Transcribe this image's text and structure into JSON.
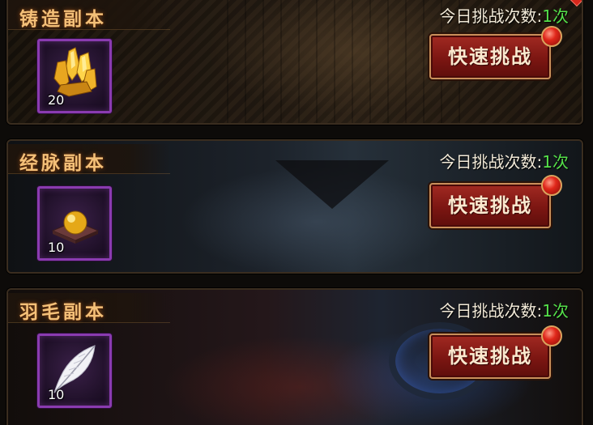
{
  "colors": {
    "title_text": "#f4c078",
    "attempts_text": "#f2ead8",
    "attempts_count": "#55e04a",
    "button_red": "#a22a22",
    "button_border": "#c98f5a",
    "slot_border_purple": "#8a3bb0",
    "notify_red": "#e0271a"
  },
  "dungeons": [
    {
      "title": "铸造副本",
      "attempts_label": "今日挑战次数:",
      "attempts_count": "1次",
      "button_label": "快速挑战",
      "reward": {
        "icon": "gold-crystal-icon",
        "quantity": "20"
      }
    },
    {
      "title": "经脉副本",
      "attempts_label": "今日挑战次数:",
      "attempts_count": "1次",
      "button_label": "快速挑战",
      "reward": {
        "icon": "golden-orb-icon",
        "quantity": "10"
      }
    },
    {
      "title": "羽毛副本",
      "attempts_label": "今日挑战次数:",
      "attempts_count": "1次",
      "button_label": "快速挑战",
      "reward": {
        "icon": "white-feather-icon",
        "quantity": "10"
      }
    }
  ]
}
